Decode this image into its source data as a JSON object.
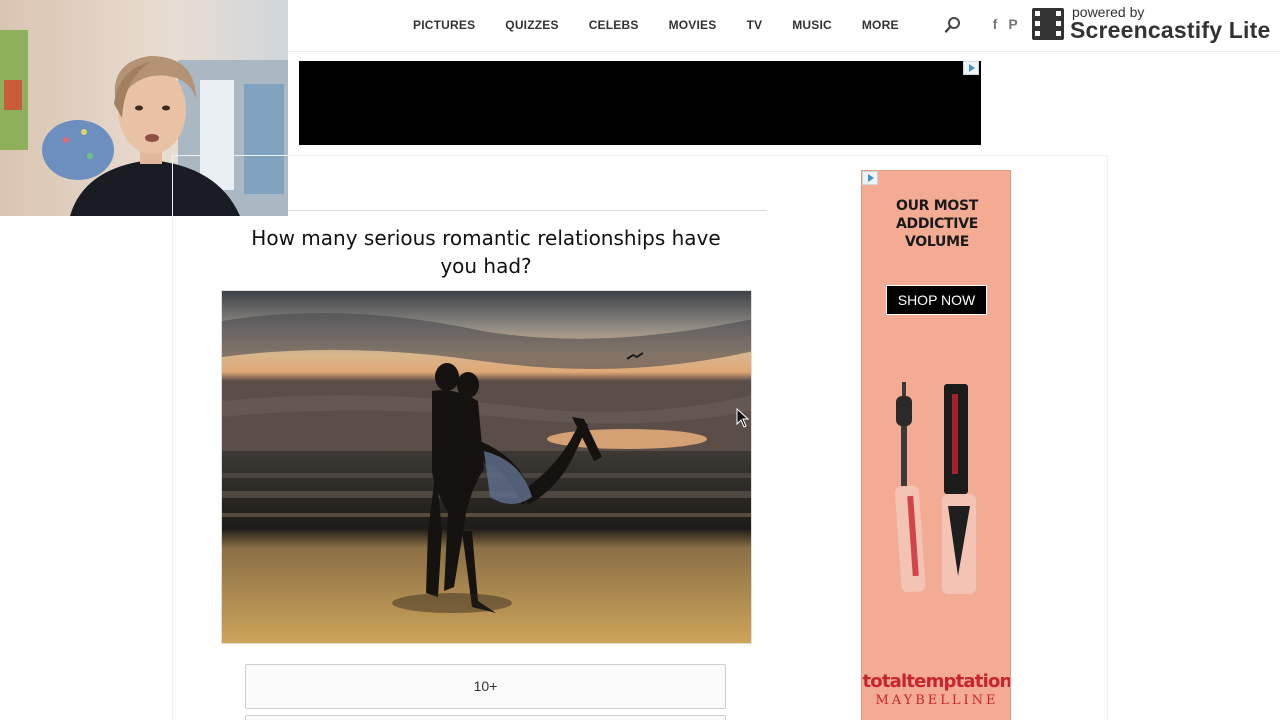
{
  "nav": {
    "items": [
      "PICTURES",
      "QUIZZES",
      "CELEBS",
      "MOVIES",
      "TV",
      "MUSIC",
      "MORE"
    ]
  },
  "social": {
    "facebook": "f",
    "pinterest": "P"
  },
  "watermark": {
    "powered_by": "powered by",
    "product": "Screencastify Lite"
  },
  "quiz": {
    "question": "How many serious romantic relationships have you had?",
    "answers": [
      "10+"
    ]
  },
  "side_ad": {
    "headline_lines": [
      "OUR MOST",
      "ADDICTIVE",
      "VOLUME"
    ],
    "cta": "SHOP NOW",
    "brand_line1": "totaltemptation",
    "brand_line2": "MAYBELLINE"
  },
  "colors": {
    "ad_background": "#f4ab93",
    "brand_red": "#c7242f",
    "nav_text": "#333333"
  },
  "icons": [
    "search-icon",
    "facebook-icon",
    "pinterest-icon",
    "screencastify-logo-icon",
    "adchoices-icon",
    "mouse-cursor-icon"
  ]
}
